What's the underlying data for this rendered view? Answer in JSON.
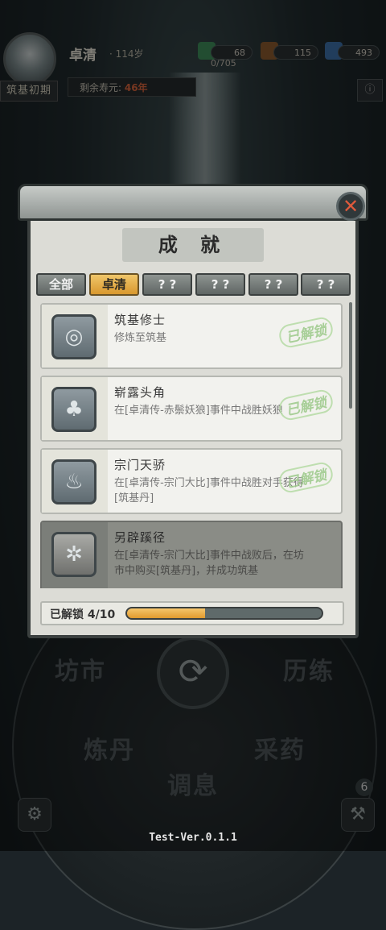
{
  "player": {
    "name": "卓清",
    "age_label": "· 114岁",
    "realm": "筑基初期",
    "exp": "0/705",
    "lifespan_prefix": "剩余寿元: ",
    "lifespan_value": "46年"
  },
  "resources": [
    {
      "icon": "herb-icon",
      "value": "68"
    },
    {
      "icon": "wood-icon",
      "value": "115"
    },
    {
      "icon": "spirit-stone-icon",
      "value": "493"
    }
  ],
  "wheel": {
    "labels": [
      "坊市",
      "历练",
      "炼丹",
      "采药",
      "调息"
    ],
    "badge_count": "6"
  },
  "dialog": {
    "title": "成 就",
    "tabs": [
      {
        "label": "全部",
        "active": false
      },
      {
        "label": "卓清",
        "active": true
      },
      {
        "label": "? ?",
        "active": false
      },
      {
        "label": "? ?",
        "active": false
      },
      {
        "label": "? ?",
        "active": false
      },
      {
        "label": "? ?",
        "active": false
      }
    ],
    "achievements": [
      {
        "name": "筑基修士",
        "desc": "修炼至筑基",
        "status": "已解锁",
        "locked": false,
        "icon": "vortex-icon"
      },
      {
        "name": "崭露头角",
        "desc": "在[卓清传-赤鬃妖狼]事件中战胜妖狼",
        "status": "已解锁",
        "locked": false,
        "icon": "sprout-icon"
      },
      {
        "name": "宗门天骄",
        "desc": "在[卓清传-宗门大比]事件中战胜对手获得[筑基丹]",
        "status": "已解锁",
        "locked": false,
        "icon": "flame-icon"
      },
      {
        "name": "另辟蹊径",
        "desc": "在[卓清传-宗门大比]事件中战败后，在坊市中购买[筑基丹]，并成功筑基",
        "status": "",
        "locked": true,
        "icon": "broken-tree-icon"
      }
    ],
    "progress": {
      "label": "已解锁 4/10",
      "fraction": 0.4
    }
  },
  "version": "Test-Ver.0.1.1"
}
